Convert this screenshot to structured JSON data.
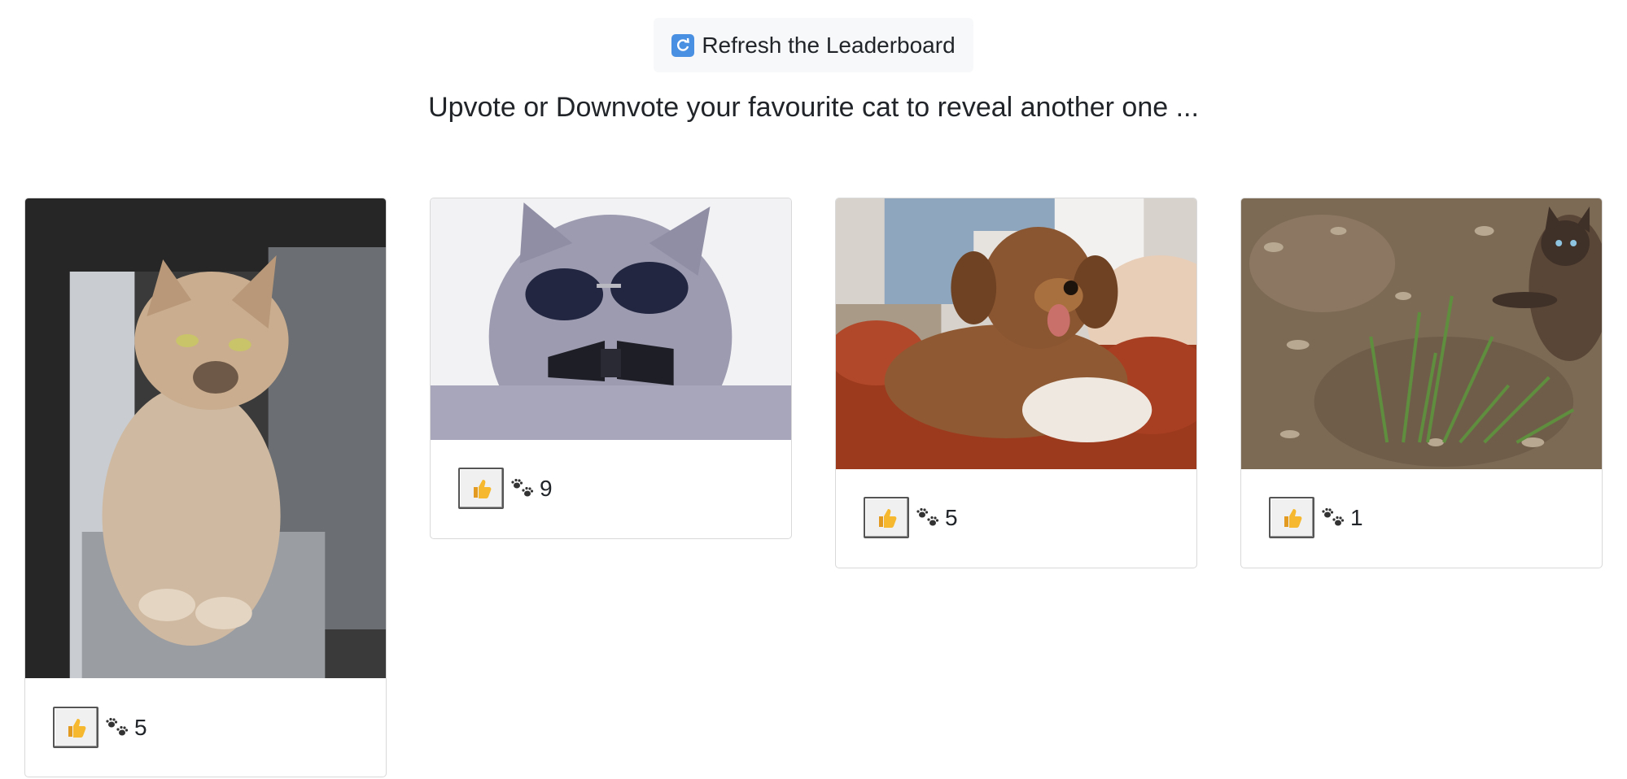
{
  "header": {
    "refresh_label": "Refresh the Leaderboard",
    "refresh_icon": "refresh-icon",
    "instruction": "Upvote or Downvote your favourite cat to reveal another one ..."
  },
  "cards": [
    {
      "subject": "grumpy cat",
      "upvote_icon": "thumbs-up-icon",
      "count_icon": "paw-prints-icon",
      "count": "5"
    },
    {
      "subject": "cat with sunglasses",
      "upvote_icon": "thumbs-up-icon",
      "count_icon": "paw-prints-icon",
      "count": "9"
    },
    {
      "subject": "puppy",
      "upvote_icon": "thumbs-up-icon",
      "count_icon": "paw-prints-icon",
      "count": "5"
    },
    {
      "subject": "cat on grass",
      "upvote_icon": "thumbs-up-icon",
      "count_icon": "paw-prints-icon",
      "count": "1"
    }
  ],
  "colors": {
    "button_bg": "#f7f8f9",
    "card_border": "#d9d9d9",
    "text": "#212529",
    "thumb": "#f5b82e"
  }
}
